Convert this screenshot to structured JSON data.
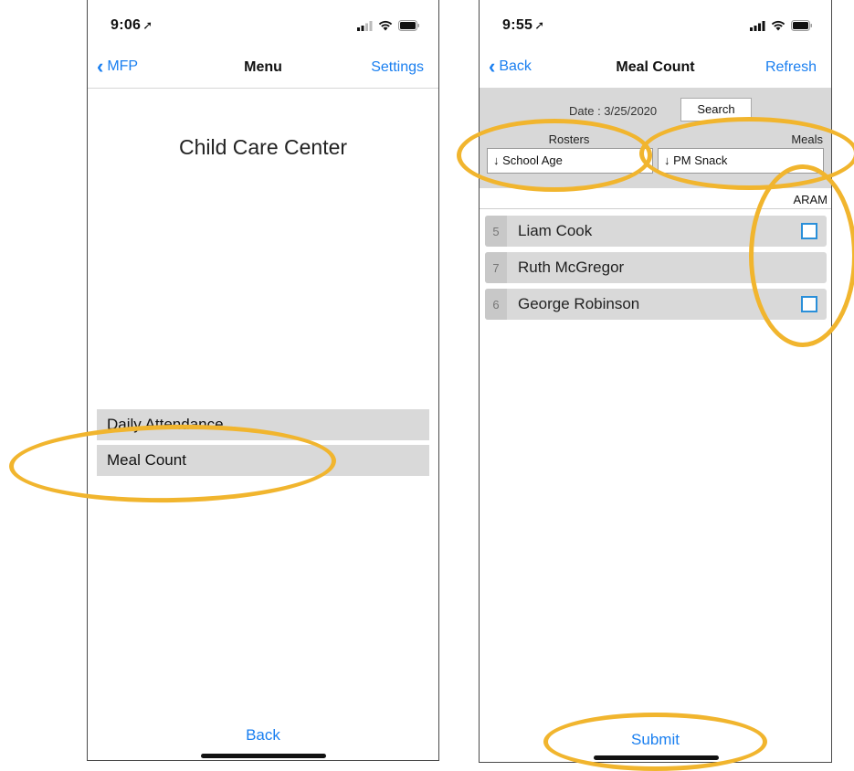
{
  "left_screen": {
    "status": {
      "time": "9:06",
      "location_arrow": "➚"
    },
    "nav": {
      "back_label": "MFP",
      "title": "Menu",
      "right_label": "Settings"
    },
    "center_title": "Child Care Center",
    "menu_items": [
      "Daily Attendance",
      "Meal Count"
    ],
    "bottom_button": "Back"
  },
  "right_screen": {
    "status": {
      "time": "9:55",
      "location_arrow": "➚"
    },
    "nav": {
      "back_label": "Back",
      "title": "Meal Count",
      "right_label": "Refresh"
    },
    "filter": {
      "date_text": "Date : 3/25/2020",
      "search_label": "Search",
      "rosters_label": "Rosters",
      "rosters_value": "↓ School Age",
      "meals_label": "Meals",
      "meals_value": "↓ PM Snack"
    },
    "column_header": "ARAM",
    "rows": [
      {
        "num": "5",
        "name": "Liam Cook",
        "checkbox": true
      },
      {
        "num": "7",
        "name": "Ruth McGregor",
        "checkbox": false
      },
      {
        "num": "6",
        "name": "George Robinson",
        "checkbox": true
      }
    ],
    "bottom_button": "Submit"
  },
  "colors": {
    "ios_blue": "#1a7ff0",
    "annotation": "#f1b52e",
    "checkbox": "#2a8fd9",
    "row_bg": "#d9d9d9"
  },
  "icons": [
    "location-arrow-icon",
    "signal-icon",
    "wifi-icon",
    "battery-icon",
    "chevron-left-icon",
    "checkbox-icon"
  ]
}
